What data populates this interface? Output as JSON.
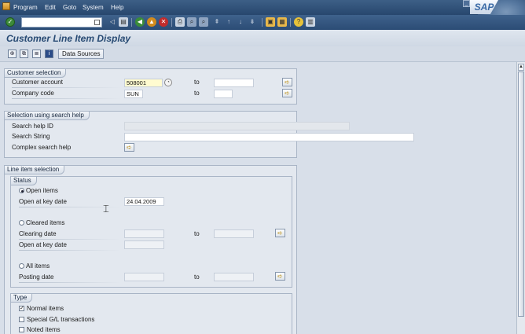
{
  "menu": {
    "items": [
      "Program",
      "Edit",
      "Goto",
      "System",
      "Help"
    ],
    "logo": "SAP"
  },
  "std_toolbar": {
    "command_field_value": ""
  },
  "title": "Customer Line Item Display",
  "app_toolbar": {
    "data_sources_label": "Data Sources"
  },
  "customer_selection": {
    "title": "Customer selection",
    "customer_account_label": "Customer account",
    "customer_account_value": "508001",
    "to_label": "to",
    "company_code_label": "Company code",
    "company_code_value": "SUN"
  },
  "search_help": {
    "title": "Selection using search help",
    "search_help_id_label": "Search help ID",
    "search_string_label": "Search String",
    "complex_search_help_label": "Complex search help"
  },
  "line_item_selection": {
    "title": "Line item selection",
    "status_title": "Status",
    "open_items_label": "Open items",
    "open_at_key_date_label": "Open at key date",
    "open_at_key_date_value": "24.04.2009",
    "cleared_items_label": "Cleared items",
    "clearing_date_label": "Clearing date",
    "to_label": "to",
    "open_at_key_date_label_2": "Open at key date",
    "all_items_label": "All items",
    "posting_date_label": "Posting date",
    "selected_status": "Open items",
    "type_title": "Type",
    "normal_items_label": "Normal items",
    "normal_items_checked": true,
    "special_gl_label": "Special G/L transactions",
    "noted_items_label": "Noted items"
  },
  "colors": {
    "header_blue": "#2b4c75",
    "title_text": "#274a73",
    "required_field": "#fffbd0"
  }
}
